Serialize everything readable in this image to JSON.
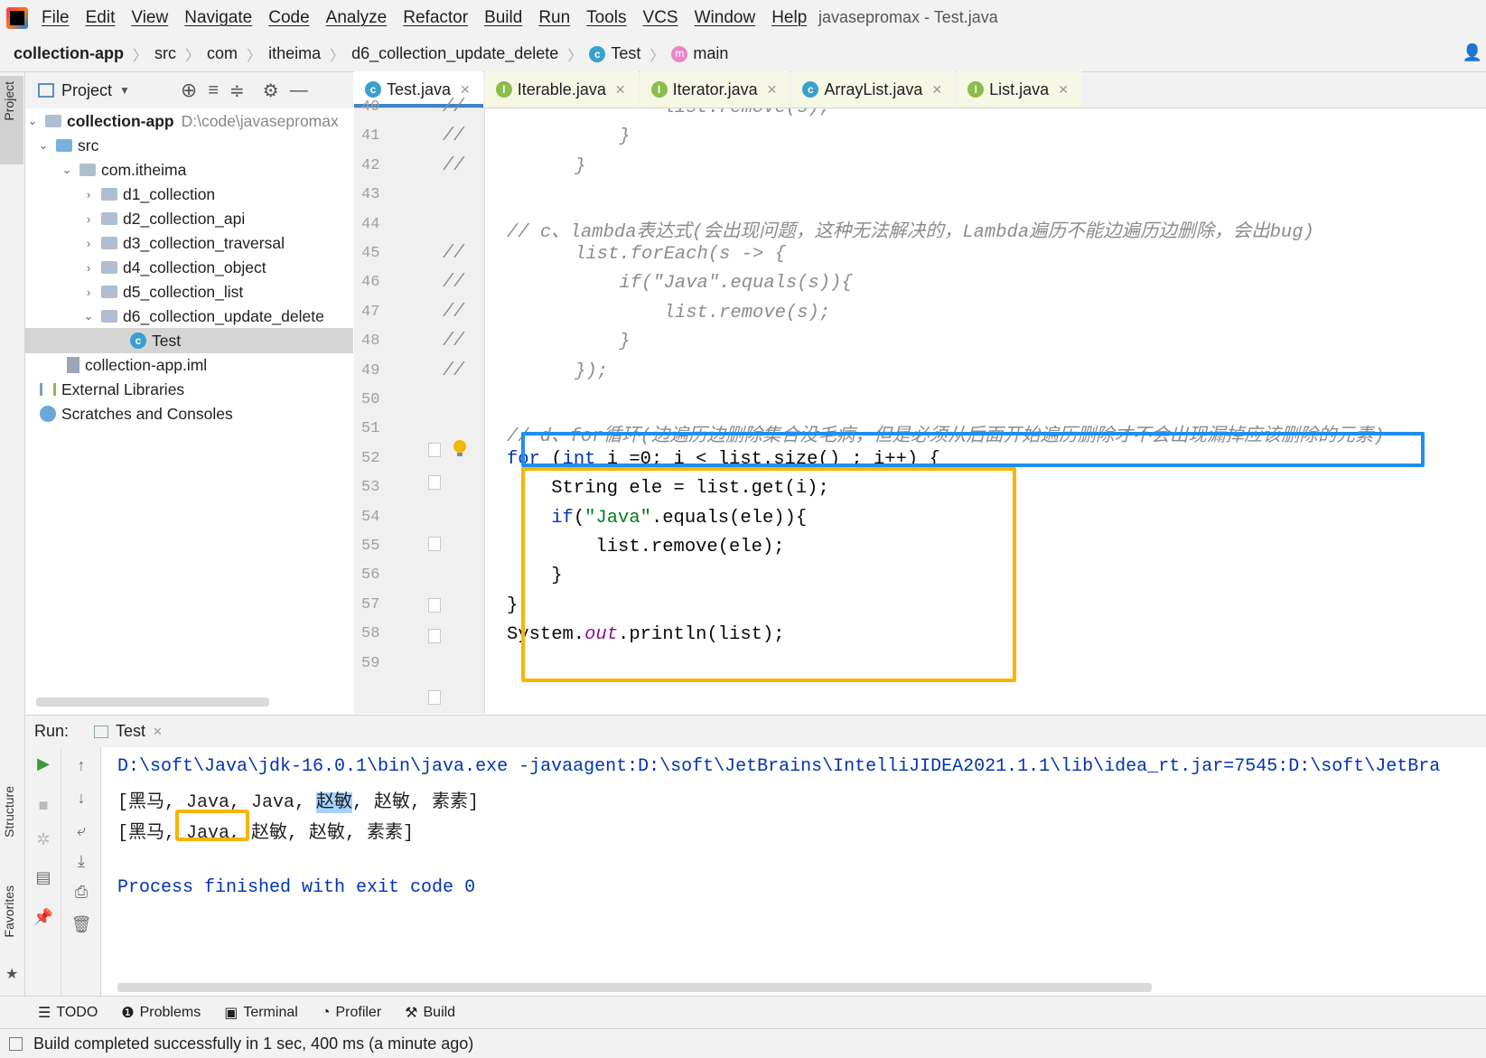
{
  "window_title": "javasepromax - Test.java",
  "menu": [
    "File",
    "Edit",
    "View",
    "Navigate",
    "Code",
    "Analyze",
    "Refactor",
    "Build",
    "Run",
    "Tools",
    "VCS",
    "Window",
    "Help"
  ],
  "breadcrumb": [
    "collection-app",
    "src",
    "com",
    "itheima",
    "d6_collection_update_delete",
    "Test",
    "main"
  ],
  "left_strip": {
    "project": "Project",
    "structure": "Structure",
    "favorites": "Favorites"
  },
  "project_panel": {
    "title": "Project",
    "tree": [
      {
        "label": "collection-app",
        "extra": "D:\\code\\javasepromax"
      },
      {
        "label": "src"
      },
      {
        "label": "com.itheima"
      },
      {
        "label": "d1_collection"
      },
      {
        "label": "d2_collection_api"
      },
      {
        "label": "d3_collection_traversal"
      },
      {
        "label": "d4_collection_object"
      },
      {
        "label": "d5_collection_list"
      },
      {
        "label": "d6_collection_update_delete"
      },
      {
        "label": "Test"
      },
      {
        "label": "collection-app.iml"
      },
      {
        "label": "External Libraries"
      },
      {
        "label": "Scratches and Consoles"
      }
    ]
  },
  "editor_tabs": [
    {
      "label": "Test.java",
      "icon": "C",
      "active": true
    },
    {
      "label": "Iterable.java",
      "icon": "I"
    },
    {
      "label": "Iterator.java",
      "icon": "I"
    },
    {
      "label": "ArrayList.java",
      "icon": "C"
    },
    {
      "label": "List.java",
      "icon": "I"
    }
  ],
  "code_lines": [
    {
      "n": "40",
      "gutter": "//",
      "text": "            list.remove(s);"
    },
    {
      "n": "41",
      "gutter": "//",
      "text": "        }"
    },
    {
      "n": "42",
      "gutter": "//",
      "text": "    }"
    },
    {
      "n": "43",
      "gutter": "",
      "text": ""
    },
    {
      "n": "44",
      "gutter": "",
      "text": "// c、lambda表达式(会出现问题，这种无法解决的，Lambda遍历不能边遍历边删除，会出bug)"
    },
    {
      "n": "45",
      "gutter": "//",
      "text": "    list.forEach(s -> {"
    },
    {
      "n": "46",
      "gutter": "//",
      "text": "        if(\"Java\".equals(s)){"
    },
    {
      "n": "47",
      "gutter": "//",
      "text": "            list.remove(s);"
    },
    {
      "n": "48",
      "gutter": "//",
      "text": "        }"
    },
    {
      "n": "49",
      "gutter": "//",
      "text": "    });"
    },
    {
      "n": "50",
      "gutter": "",
      "text": ""
    },
    {
      "n": "51",
      "gutter": "",
      "text": "// d、for循环(边遍历边删除集合没毛病，但是必须从后面开始遍历删除才不会出现漏掉应该删除的元素)"
    },
    {
      "n": "52",
      "gutter": "",
      "text": "for (int i =0; i < list.size() ; i++) {"
    },
    {
      "n": "53",
      "gutter": "",
      "text": "    String ele = list.get(i);"
    },
    {
      "n": "54",
      "gutter": "",
      "text": "    if(\"Java\".equals(ele)){"
    },
    {
      "n": "55",
      "gutter": "",
      "text": "        list.remove(ele);"
    },
    {
      "n": "56",
      "gutter": "",
      "text": "    }"
    },
    {
      "n": "57",
      "gutter": "",
      "text": "}"
    },
    {
      "n": "58",
      "gutter": "",
      "text": "System.out.println(list);"
    },
    {
      "n": "59",
      "gutter": "",
      "text": "}"
    }
  ],
  "run_panel": {
    "label": "Run:",
    "tab": "Test",
    "cmd": "D:\\soft\\Java\\jdk-16.0.1\\bin\\java.exe -javaagent:D:\\soft\\JetBrains\\IntelliJIDEA2021.1.1\\lib\\idea_rt.jar=7545:D:\\soft\\JetBra",
    "out1_pre": "[黑马, Java, Java, ",
    "out1_sel": "赵敏",
    "out1_post": ", 赵敏, 素素]",
    "out2_pre": "[黑马, ",
    "out2_box": "Java,",
    "out2_post": " 赵敏, 赵敏, 素素]",
    "done": "Process finished with exit code 0"
  },
  "tool_windows": [
    "TODO",
    "Problems",
    "Terminal",
    "Profiler",
    "Build"
  ],
  "status": "Build completed successfully in 1 sec, 400 ms (a minute ago)",
  "colors": {
    "highlight_blue": "#1f8ef1",
    "highlight_orange": "#f7b500",
    "keyword": "#0033b3",
    "string": "#067d17"
  }
}
